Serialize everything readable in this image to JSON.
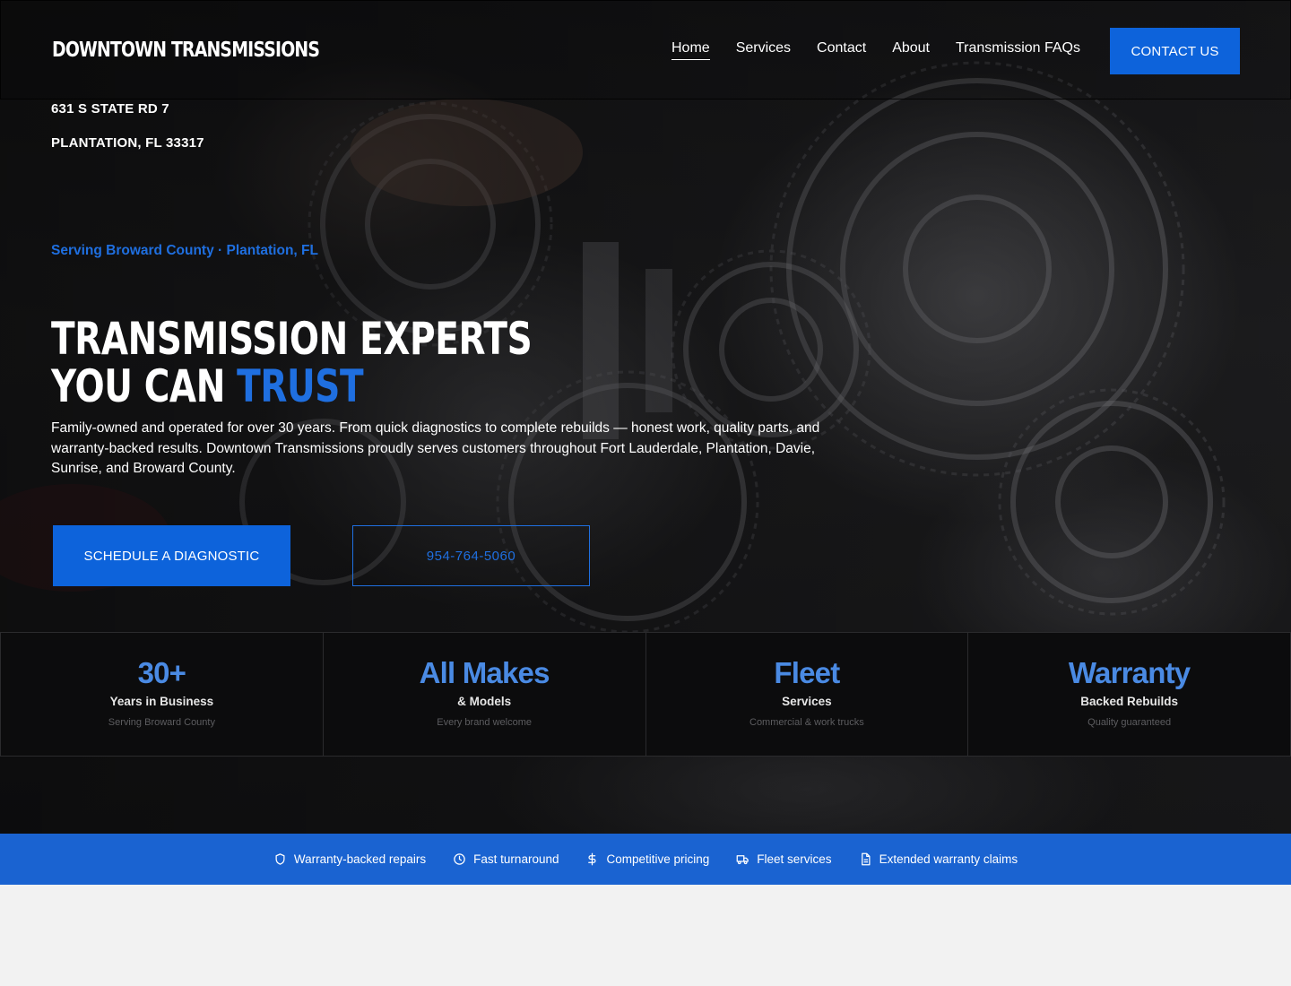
{
  "brand": {
    "name": "DOWNTOWN TRANSMISSIONS"
  },
  "nav": {
    "links": [
      {
        "label": "Home",
        "active": true
      },
      {
        "label": "Services",
        "active": false
      },
      {
        "label": "Contact",
        "active": false
      },
      {
        "label": "About",
        "active": false
      },
      {
        "label": "Transmission FAQs",
        "active": false
      }
    ],
    "cta_label": "CONTACT US"
  },
  "address": {
    "line1": "631 S STATE RD 7",
    "line2": "PLANTATION, FL 33317"
  },
  "hero": {
    "tagline": "Serving Broward County · Plantation, FL",
    "headline_line1": "TRANSMISSION EXPERTS",
    "headline_line2_prefix": "YOU CAN ",
    "headline_line2_accent": "TRUST",
    "intro": "Family-owned and operated for over 30 years. From quick diagnostics to complete rebuilds — honest work, quality parts, and warranty-backed results. Downtown Transmissions proudly serves customers throughout Fort Lauderdale, Plantation, Davie, Sunrise, and Broward County.",
    "primary_button": "SCHEDULE A DIAGNOSTIC",
    "phone_button": "954-764-5060"
  },
  "stats": [
    {
      "value": "30+",
      "label": "Years in Business",
      "sub": "Serving Broward County"
    },
    {
      "value": "All Makes",
      "label": "& Models",
      "sub": "Every brand welcome"
    },
    {
      "value": "Fleet",
      "label": "Services",
      "sub": "Commercial & work trucks"
    },
    {
      "value": "Warranty",
      "label": "Backed Rebuilds",
      "sub": "Quality guaranteed"
    }
  ],
  "features": [
    {
      "icon": "shield-icon",
      "label": "Warranty-backed repairs"
    },
    {
      "icon": "clock-icon",
      "label": "Fast turnaround"
    },
    {
      "icon": "dollar-icon",
      "label": "Competitive pricing"
    },
    {
      "icon": "truck-icon",
      "label": "Fleet services"
    },
    {
      "icon": "document-icon",
      "label": "Extended warranty claims"
    }
  ],
  "colors": {
    "accent": "#0d63db",
    "accent_text": "#1f6fe0",
    "stat_value": "#4a8ae3",
    "feature_bar": "#1a63d1"
  }
}
